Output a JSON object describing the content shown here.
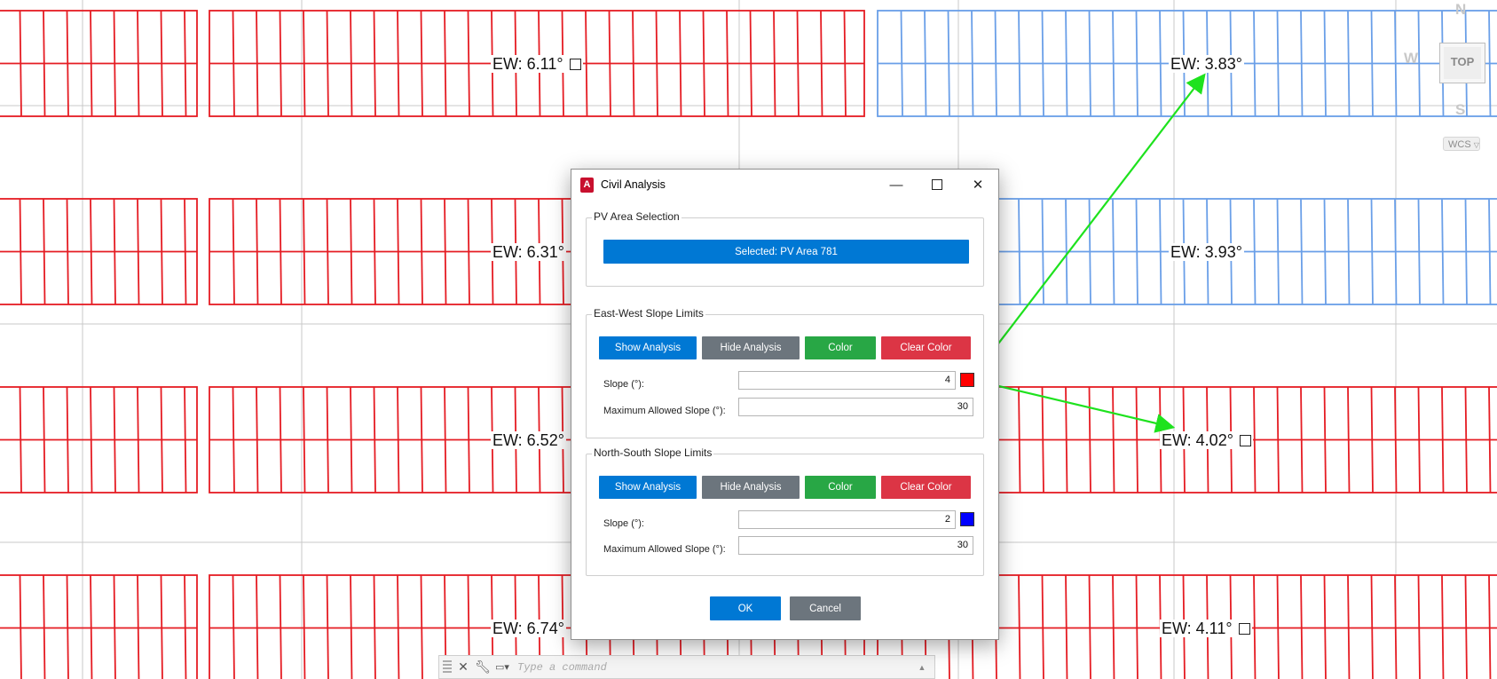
{
  "canvas": {
    "arrow_color": "#1ee21e",
    "red_color": "#e51c23",
    "blue_color": "#6a9fe8",
    "labels": {
      "r1_left": "EW: 6.11°",
      "r1_right": "EW: 3.83°",
      "r2_left": "EW: 6.31°",
      "r2_right": "EW: 3.93°",
      "r3_left": "EW: 6.52°",
      "r3_right": "EW: 4.02°",
      "r4_left": "EW: 6.74°",
      "r4_right": "EW: 4.11°"
    }
  },
  "navcube": {
    "north": "N",
    "west": "W",
    "south": "S",
    "face": "TOP",
    "wcs": "WCS"
  },
  "command_line": {
    "placeholder": "Type a command"
  },
  "dialog": {
    "title": "Civil Analysis",
    "pv_area": {
      "legend": "PV Area Selection",
      "selected_button": "Selected: PV Area 781"
    },
    "east_west": {
      "legend": "East-West Slope Limits",
      "show_analysis": "Show Analysis",
      "hide_analysis": "Hide Analysis",
      "color": "Color",
      "clear_color": "Clear Color",
      "slope_label": "Slope (°):",
      "slope_value": "4",
      "max_label": "Maximum Allowed Slope (°):",
      "max_value": "30",
      "swatch_color": "#ff0000"
    },
    "north_south": {
      "legend": "North-South Slope Limits",
      "show_analysis": "Show Analysis",
      "hide_analysis": "Hide Analysis",
      "color": "Color",
      "clear_color": "Clear Color",
      "slope_label": "Slope (°):",
      "slope_value": "2",
      "max_label": "Maximum Allowed Slope (°):",
      "max_value": "30",
      "swatch_color": "#0000ff"
    },
    "ok": "OK",
    "cancel": "Cancel"
  }
}
